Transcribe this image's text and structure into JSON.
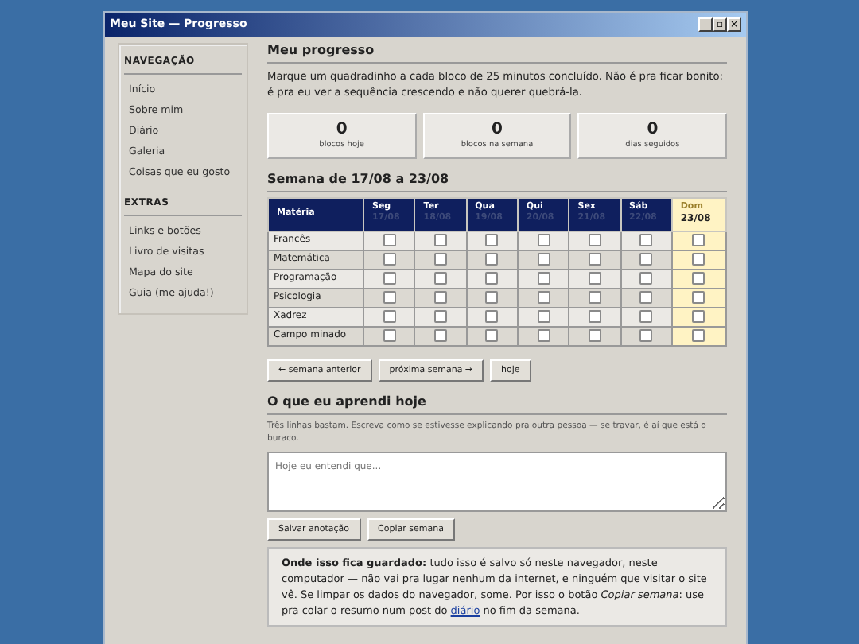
{
  "window": {
    "title": "Meu Site — Progresso",
    "controls": [
      "_",
      "▫",
      "×"
    ]
  },
  "sidebar": [
    {
      "heading": "NAVEGAÇÃO",
      "items": [
        "Início",
        "Sobre mim",
        "Diário",
        "Galeria",
        "Coisas que eu gosto"
      ]
    },
    {
      "heading": "EXTRAS",
      "items": [
        "Links e botões",
        "Livro de visitas",
        "Mapa do site",
        "Guia (me ajuda!)"
      ]
    }
  ],
  "title": "Meu progresso",
  "intro": "Marque um quadradinho a cada bloco de 25 minutos concluído. Não é pra ficar bonito: é pra eu ver a sequência crescendo e não querer quebrá-la.",
  "stats": [
    {
      "value": "0",
      "label": "blocos hoje"
    },
    {
      "value": "0",
      "label": "blocos na semana"
    },
    {
      "value": "0",
      "label": "dias seguidos"
    }
  ],
  "week_title": "Semana de 17/08 a 23/08",
  "table": {
    "first_column": "Matéria",
    "days": [
      {
        "name": "Seg",
        "date": "17/08",
        "today": false
      },
      {
        "name": "Ter",
        "date": "18/08",
        "today": false
      },
      {
        "name": "Qua",
        "date": "19/08",
        "today": false
      },
      {
        "name": "Qui",
        "date": "20/08",
        "today": false
      },
      {
        "name": "Sex",
        "date": "21/08",
        "today": false
      },
      {
        "name": "Sáb",
        "date": "22/08",
        "today": false
      },
      {
        "name": "Dom",
        "date": "23/08",
        "today": true
      }
    ],
    "rows": [
      {
        "subject": "Francês",
        "checked": [
          false,
          false,
          false,
          false,
          false,
          false,
          false
        ]
      },
      {
        "subject": "Matemática",
        "checked": [
          false,
          false,
          false,
          false,
          false,
          false,
          false
        ]
      },
      {
        "subject": "Programação",
        "checked": [
          false,
          false,
          false,
          false,
          false,
          false,
          false
        ]
      },
      {
        "subject": "Psicologia",
        "checked": [
          false,
          false,
          false,
          false,
          false,
          false,
          false
        ]
      },
      {
        "subject": "Xadrez",
        "checked": [
          false,
          false,
          false,
          false,
          false,
          false,
          false
        ]
      },
      {
        "subject": "Campo minado",
        "checked": [
          false,
          false,
          false,
          false,
          false,
          false,
          false
        ]
      }
    ]
  },
  "week_buttons": [
    "← semana anterior",
    "próxima semana →",
    "hoje"
  ],
  "learned": {
    "title": "O que eu aprendi hoje",
    "hint": "Três linhas bastam. Escreva como se estivesse explicando pra outra pessoa — se travar, é aí que está o buraco.",
    "placeholder": "Hoje eu entendi que...",
    "buttons": [
      "Salvar anotação",
      "Copiar semana"
    ]
  },
  "note": {
    "text": "**Onde isso fica guardado:** tudo isso é salvo só neste navegador, neste computador — não vai pra lugar nenhum da internet, e ninguém que visitar o site vê. Se limpar os dados do navegador, some. Por isso o botão *Copiar semana*: use pra colar o resumo num post do",
    "link": "diário",
    "after": "no fim da semana."
  }
}
